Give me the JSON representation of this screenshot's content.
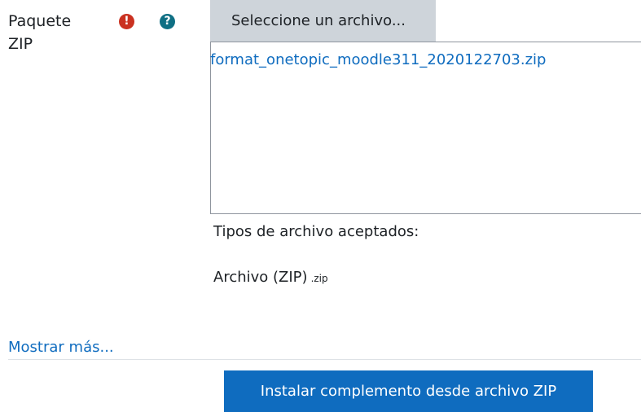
{
  "field": {
    "label": "Paquete ZIP",
    "required_icon": "exclamation-circle-icon",
    "help_icon": "question-circle-icon",
    "required_glyph": "!",
    "help_glyph": "?"
  },
  "filepicker": {
    "choose_label": "Seleccione un archivo...",
    "selected_file": "format_onetopic_moodle311_2020122703.zip"
  },
  "accepted": {
    "title": "Tipos de archivo aceptados:",
    "type_name": "Archivo (ZIP)",
    "type_ext": ".zip"
  },
  "footer": {
    "show_more": "Mostrar más...",
    "submit_label": "Instalar complemento desde archivo ZIP"
  },
  "colors": {
    "required": "#ca3120",
    "help": "#0f6f84",
    "link": "#0f6cbf",
    "primary_button": "#0f6cbf",
    "secondary_button": "#ced4da"
  }
}
